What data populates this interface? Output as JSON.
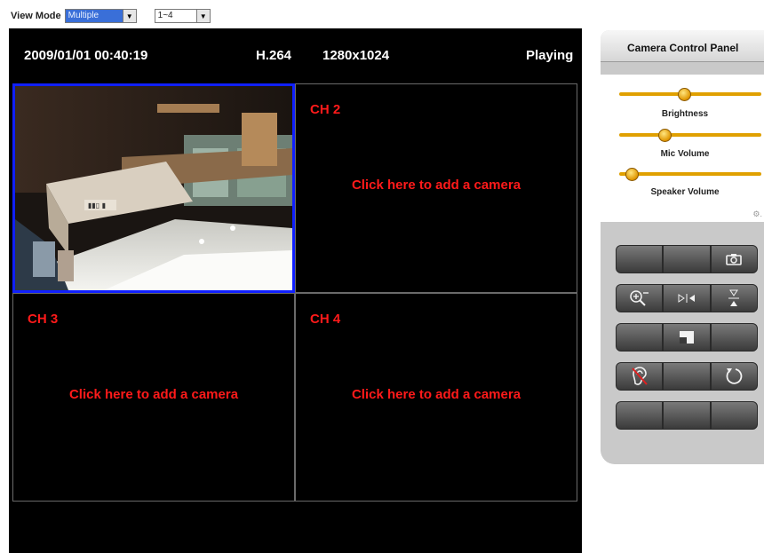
{
  "view_mode": {
    "label": "View Mode",
    "mode_value": "Multiple",
    "range_value": "1~4",
    "arrow_glyph": "▼"
  },
  "info_bar": {
    "datetime": "2009/01/01  00:40:19",
    "codec": "H.264",
    "resolution": "1280x1024",
    "status": "Playing"
  },
  "channels": [
    {
      "label": "",
      "add_text": ""
    },
    {
      "label": "CH 2",
      "add_text": "Click here to add a camera"
    },
    {
      "label": "CH 3",
      "add_text": "Click here to add a camera"
    },
    {
      "label": "CH 4",
      "add_text": "Click here to add a camera"
    }
  ],
  "panel": {
    "title": "Camera Control Panel",
    "sliders": [
      {
        "label": "Brightness",
        "value": 0.45
      },
      {
        "label": "Mic Volume",
        "value": 0.3
      },
      {
        "label": "Speaker Volume",
        "value": 0.05
      }
    ],
    "icons": [
      "snapshot-icon",
      "zoom-icon",
      "flip-horizontal-icon",
      "flip-vertical-icon",
      "pip-icon",
      "listen-off-icon",
      "rotate-icon"
    ]
  },
  "colors": {
    "accent_red": "#ff1a1a",
    "selected_border": "#1020ff",
    "slider_track": "#e0a000"
  }
}
